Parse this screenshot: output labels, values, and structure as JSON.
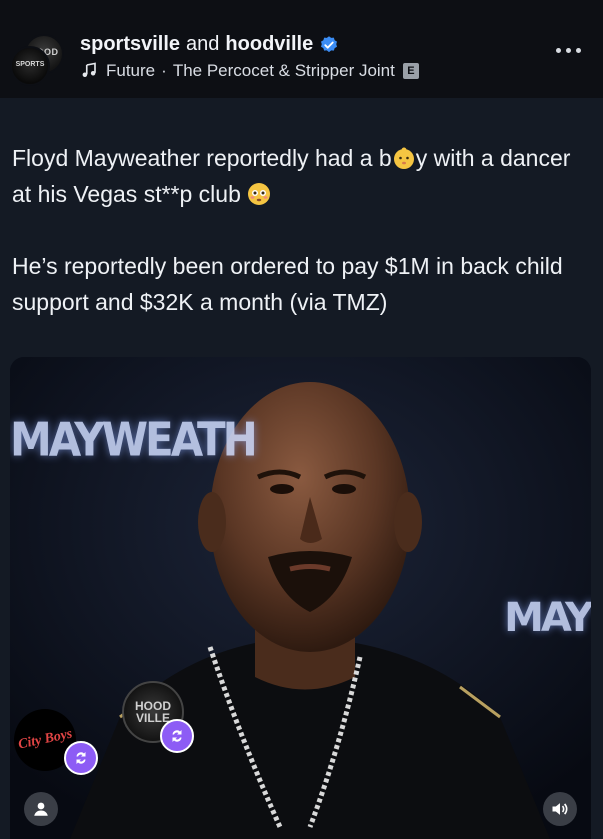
{
  "post": {
    "author_primary": "sportsville",
    "author_conjunction": "and",
    "author_secondary": "hoodville",
    "verified_icon": "verified-badge-icon",
    "music_artist": "Future",
    "music_separator": "·",
    "music_title": "The Percocet & Stripper Joint",
    "explicit_label": "E",
    "avatar_a_text": "HOOD",
    "avatar_b_text": "SPORTS",
    "more_icon": "more-horizontal-icon",
    "caption": {
      "line1_part1": "Floyd Mayweather reportedly had a b",
      "line1_part2": "y with a dancer at his Vegas st**p club ",
      "line2": "He’s reportedly been ordered to pay $1M in back child support and $32K a month (via TMZ)"
    }
  },
  "media": {
    "banner_left": "MAYWEATH",
    "banner_right": "MAY",
    "city_badge_text": "City Boys",
    "hood_badge_text": "HOOD VILLE",
    "user_icon": "user-icon",
    "sound_icon": "sound-on-icon",
    "repost_icon": "repost-icon"
  },
  "colors": {
    "background": "#141a24",
    "header": "#0d0f14",
    "verified": "#3b8df5",
    "repost_badge": "#8d5cf5"
  }
}
